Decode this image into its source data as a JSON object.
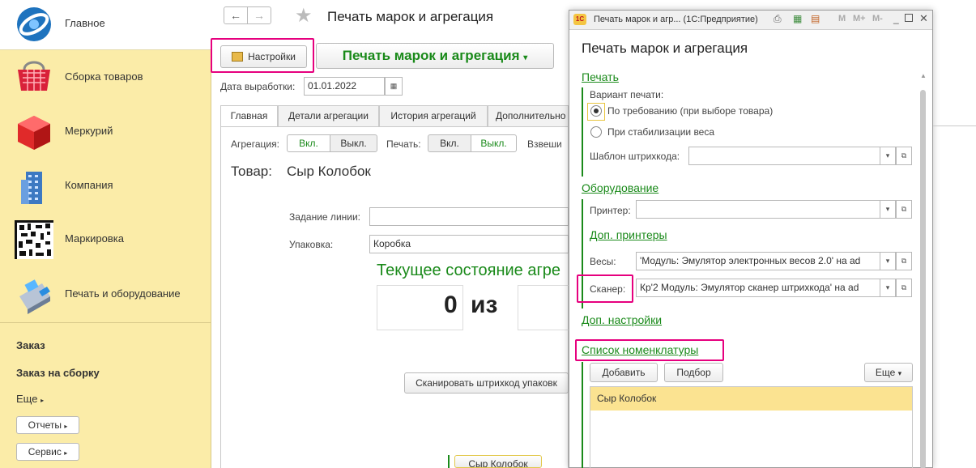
{
  "sidebar": {
    "items": [
      {
        "label": "Главное",
        "icon": "home-icon"
      },
      {
        "label": "Сборка товаров",
        "icon": "basket-icon"
      },
      {
        "label": "Меркурий",
        "icon": "cube-icon"
      },
      {
        "label": "Компания",
        "icon": "building-icon"
      },
      {
        "label": "Маркировка",
        "icon": "datamatrix-icon"
      },
      {
        "label": "Печать и оборудование",
        "icon": "terminal-icon"
      }
    ],
    "links": [
      "Заказ",
      "Заказ на сборку"
    ],
    "more": "Еще",
    "buttons": [
      "Отчеты",
      "Сервис"
    ]
  },
  "main": {
    "title": "Печать марок и агрегация",
    "settings_button": "Настройки",
    "menu_button": "Печать марок и агрегация",
    "date_label": "Дата выработки:",
    "date_value": "01.01.2022",
    "tabs": [
      "Главная",
      "Детали агрегации",
      "История агрегаций",
      "Дополнительно"
    ],
    "aggregation_label": "Агрегация:",
    "print_label": "Печать:",
    "weigh_label": "Взвеши",
    "on": "Вкл.",
    "off": "Выкл.",
    "product_label": "Товар:",
    "product_value": "Сыр Колобок",
    "line_task_label": "Задание линии:",
    "line_task_value": "",
    "package_label": "Упаковка:",
    "package_value": "Коробка",
    "state_title": "Текущее состояние агре",
    "counter_value": "0",
    "counter_of": "из",
    "scan_button": "Сканировать штрихкод упаковк",
    "bottom_item": "Сыр Колобок"
  },
  "dialog": {
    "window_title": "Печать марок и агр... (1С:Предприятие)",
    "heading": "Печать марок и агрегация",
    "print_section": "Печать",
    "print_variant_label": "Вариант печати:",
    "radio_on_demand": "По требованию (при выборе товара)",
    "radio_on_weight": "При стабилизации веса",
    "barcode_template_label": "Шаблон штрихкода:",
    "barcode_template_value": "",
    "equipment_section": "Оборудование",
    "printer_label": "Принтер:",
    "printer_value": "",
    "extra_printers_link": "Доп. принтеры",
    "scales_label": "Весы:",
    "scales_value": "'Модуль: Эмулятор электронных весов 2.0' на ad",
    "scanner_label": "Сканер:",
    "scanner_value": "Кр'2 Модуль: Эмулятор сканер штрихкода' на ad",
    "extra_settings_link": "Доп. настройки",
    "nomenclature_section": "Список номенклатуры",
    "add_button": "Добавить",
    "pick_button": "Подбор",
    "more_button": "Еще",
    "list_item": "Сыр Колобок"
  }
}
